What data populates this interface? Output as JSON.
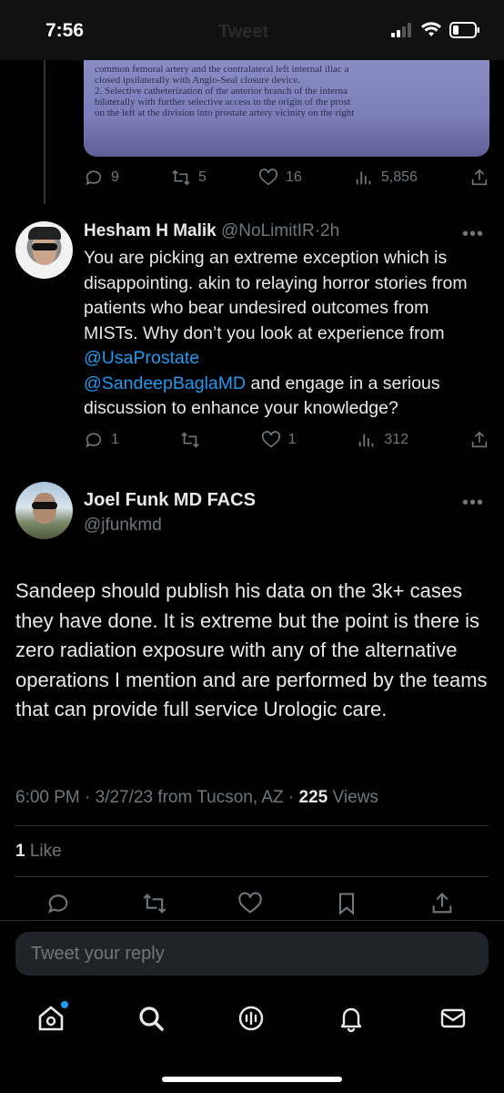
{
  "status": {
    "time": "7:56",
    "header_title": "Tweet"
  },
  "quoted_image": {
    "lines": [
      "common femoral artery and the contralateral left internal iliac a",
      "closed ipsilaterally with Angio-Seal closure device.",
      "2. Selective catheterization of the anterior branch of the interna",
      "bilaterally with further selective access to the origin of the prost",
      "on the left at the division into prostate artery vicinity on the right"
    ]
  },
  "top_actions": {
    "replies": "9",
    "retweets": "5",
    "likes": "16",
    "views": "5,856"
  },
  "reply_tweet": {
    "name": "Hesham H Malik",
    "handle": "@NoLimitIR",
    "time": "2h",
    "text_1": "You are picking an extreme exception which is disappointing.  akin to relaying horror stories from patients who bear undesired outcomes from MISTs. Why don’t you look at experience from ",
    "mention_1": "@UsaProstate",
    "mention_2": "@SandeepBaglaMD",
    "text_2": " and engage in a serious discussion to enhance your knowledge?",
    "replies": "1",
    "likes": "1",
    "views": "312"
  },
  "main_tweet": {
    "name": "Joel Funk MD FACS",
    "handle": "@jfunkmd",
    "text": "Sandeep should publish his data on  the 3k+ cases they have done. It is extreme but the point is there is zero radiation exposure with any of the alternative operations I mention and are performed by the teams that can provide full service Urologic care.",
    "timestamp": "6:00 PM · 3/27/23 from Tucson, AZ · ",
    "views_count": "225",
    "views_label": " Views",
    "likes_count": "1",
    "likes_label": " Like"
  },
  "reply_box": {
    "placeholder": "Tweet your reply"
  },
  "colors": {
    "accent": "#1d9bf0",
    "muted": "#71767b",
    "text": "#e7e9ea",
    "background": "#000000"
  },
  "icons": [
    "signal-icon",
    "wifi-icon",
    "battery-icon",
    "reply-icon",
    "retweet-icon",
    "like-icon",
    "views-icon",
    "share-icon",
    "bookmark-icon",
    "home-icon",
    "search-icon",
    "spaces-icon",
    "notifications-icon",
    "messages-icon"
  ]
}
